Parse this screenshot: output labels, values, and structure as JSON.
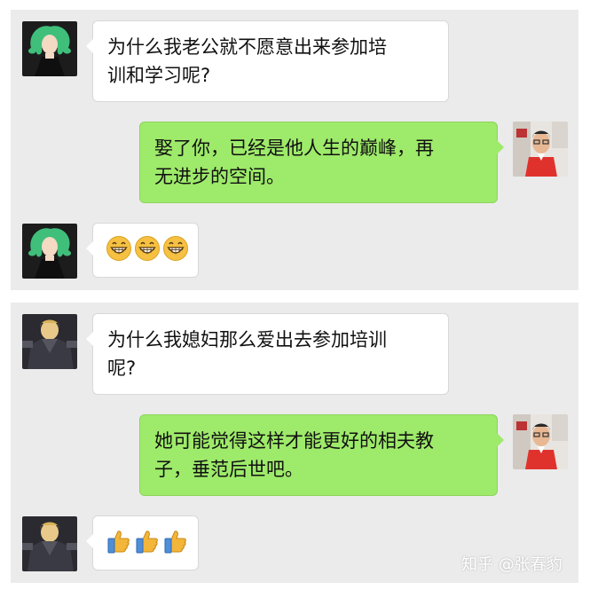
{
  "panel1": {
    "messages": [
      {
        "side": "left",
        "type": "text",
        "lines": [
          "为什么我老公就不愿意出来参加培",
          "训和学习呢?"
        ]
      },
      {
        "side": "right",
        "type": "text",
        "lines": [
          "娶了你，已经是他人生的巅峰，再",
          "无进步的空间。"
        ]
      },
      {
        "side": "left",
        "type": "emoji",
        "emoji": [
          "grin-emoji",
          "grin-emoji",
          "grin-emoji"
        ]
      }
    ]
  },
  "panel2": {
    "messages": [
      {
        "side": "left",
        "type": "text",
        "lines": [
          "为什么我媳妇那么爱出去参加培训",
          "呢?"
        ]
      },
      {
        "side": "right",
        "type": "text",
        "lines": [
          "她可能觉得这样才能更好的相夫教",
          "子，垂范后世吧。"
        ]
      },
      {
        "side": "left",
        "type": "emoji",
        "emoji": [
          "thumbs-up-emoji",
          "thumbs-up-emoji",
          "thumbs-up-emoji"
        ]
      }
    ]
  },
  "watermark": "知乎 @张春豹",
  "colors": {
    "panel_bg": "#ebebeb",
    "bubble_left": "#ffffff",
    "bubble_right": "#9eea6a"
  }
}
